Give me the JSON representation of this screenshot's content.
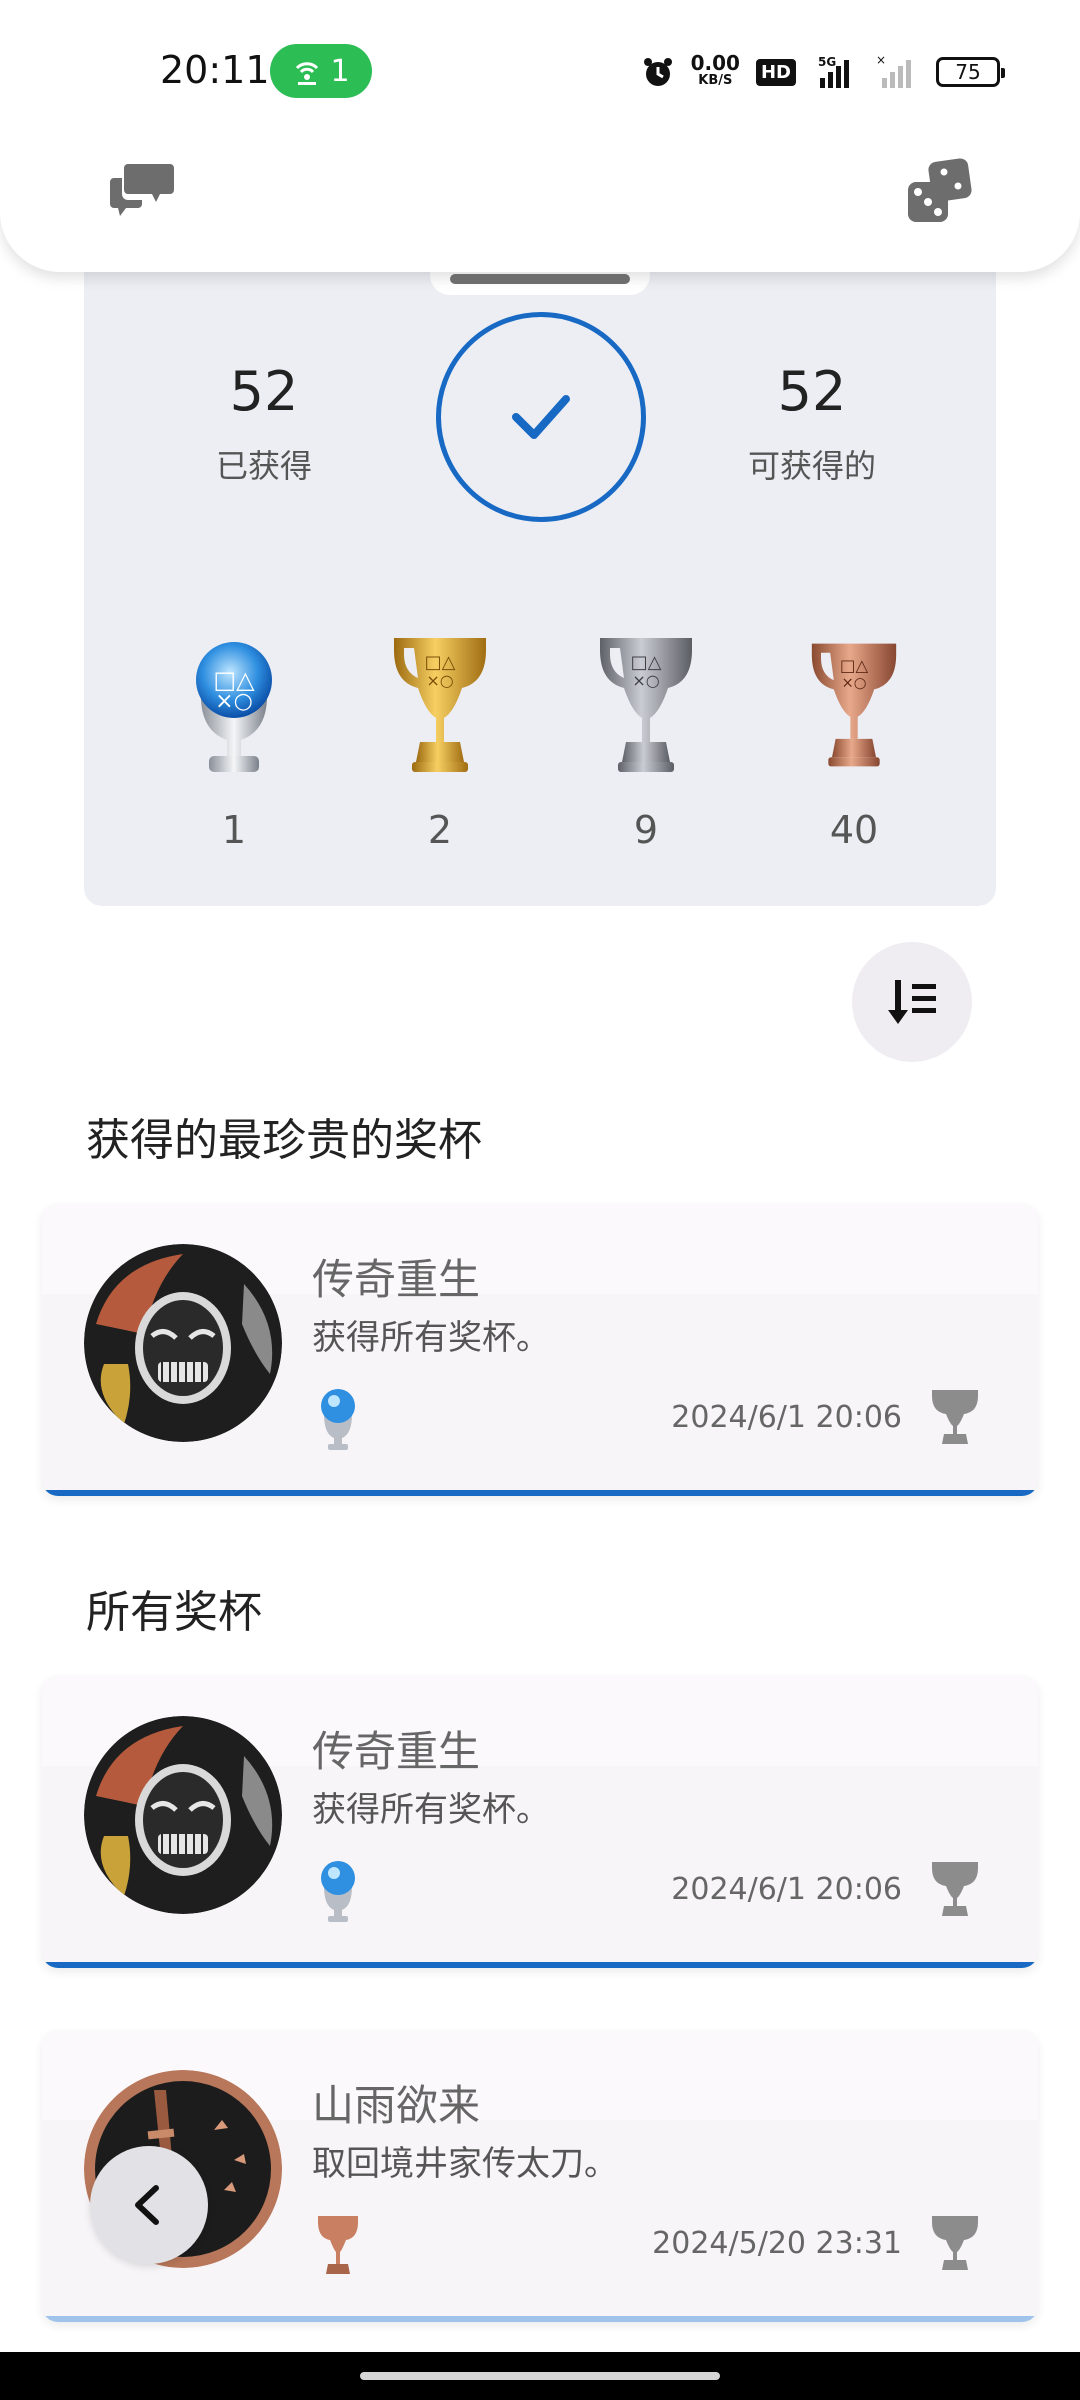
{
  "status_bar": {
    "time": "20:11",
    "hotspot_count": "1",
    "net_speed_value": "0.00",
    "net_speed_unit": "KB/S",
    "hd_label": "HD",
    "signal_label": "5G",
    "battery": "75"
  },
  "header": {
    "left_icon": "chat-bubbles-icon",
    "right_icon": "dice-icon"
  },
  "summary": {
    "earned_count": "52",
    "earned_label": "已获得",
    "available_count": "52",
    "available_label": "可获得的",
    "progress": 1.0,
    "trophies": [
      {
        "grade": "platinum",
        "count": "1"
      },
      {
        "grade": "gold",
        "count": "2"
      },
      {
        "grade": "silver",
        "count": "9"
      },
      {
        "grade": "bronze",
        "count": "40"
      }
    ]
  },
  "sections": {
    "rarest_title": "获得的最珍贵的奖杯",
    "all_title": "所有奖杯"
  },
  "rarest_trophies": [
    {
      "name": "传奇重生",
      "description": "获得所有奖杯。",
      "grade": "platinum",
      "date": "2024/6/1  20:06"
    }
  ],
  "all_trophies": [
    {
      "name": "传奇重生",
      "description": "获得所有奖杯。",
      "grade": "platinum",
      "date": "2024/6/1  20:06"
    },
    {
      "name": "山雨欲来",
      "description": "取回境井家传太刀。",
      "grade": "bronze",
      "date": "2024/5/20  23:31"
    }
  ],
  "colors": {
    "accent": "#1769c4",
    "card_bg": "#eceef4",
    "hotspot_green": "#2dbd55"
  }
}
